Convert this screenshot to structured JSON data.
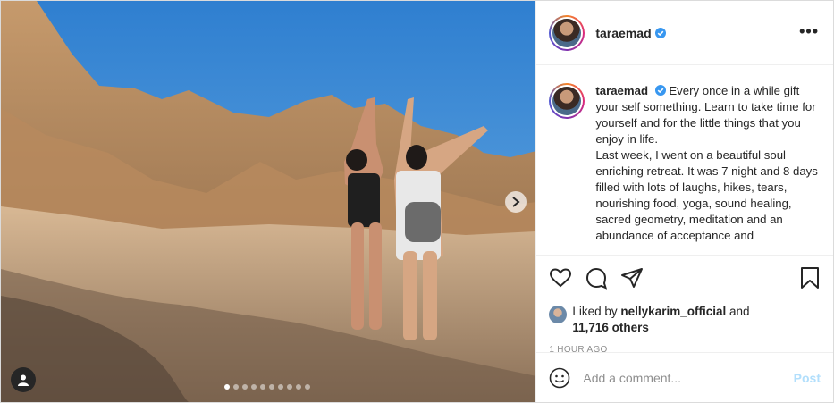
{
  "post": {
    "username": "taraemad",
    "verified": true,
    "more_icon": "more-horizontal-icon",
    "caption": [
      "Every once in a while gift your self something. Learn to take time for yourself and for the little things that you enjoy in life.",
      "Last week, I went on a beautiful soul enriching retreat. It was 7 night and 8 days filled with lots of laughs, hikes, tears, nourishing food, yoga, sound healing, sacred geometry, meditation and an abundance of acceptance and"
    ],
    "liked_by_prefix": "Liked by",
    "liked_by_user": "nellykarim_official",
    "liked_by_and": "and",
    "likes_others": "11,716 others",
    "time": "1 HOUR AGO",
    "carousel": {
      "count": 10,
      "active": 0
    }
  },
  "comment": {
    "placeholder": "Add a comment...",
    "post_label": "Post"
  },
  "colors": {
    "sky": "#3f87cf",
    "post_disabled": "#b2dffc",
    "verified": "#3897f0"
  }
}
